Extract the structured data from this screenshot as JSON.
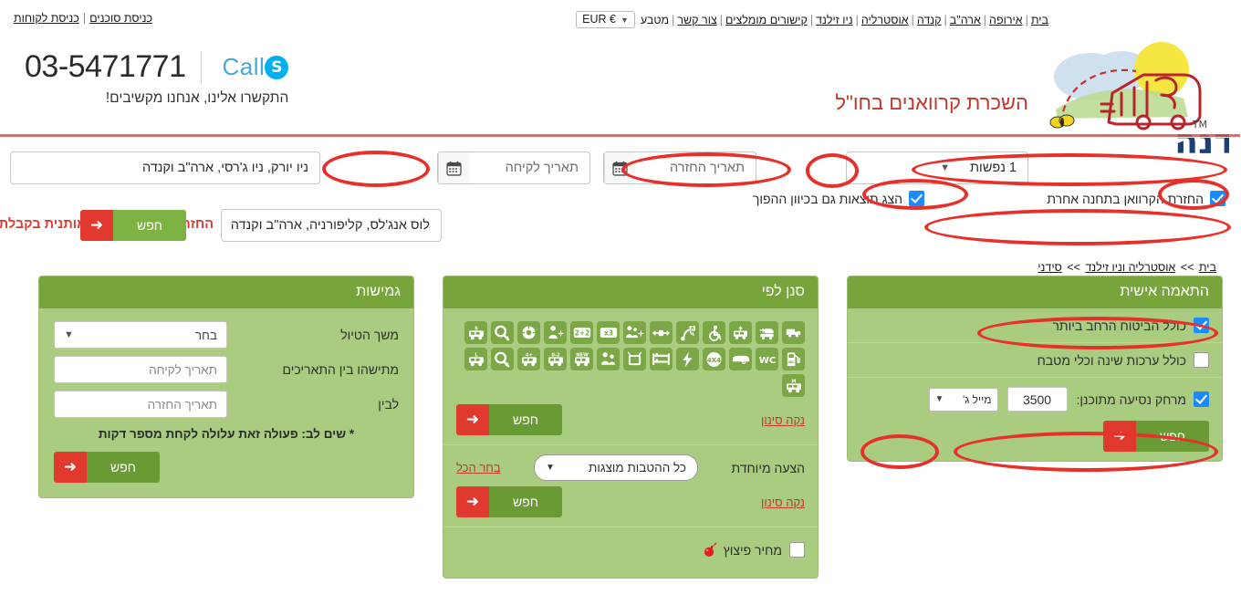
{
  "topbar": {
    "left_links": [
      {
        "label": "כניסת סוכנים"
      },
      {
        "label": "כניסת לקוחות"
      }
    ],
    "nav_links": [
      {
        "label": "בית"
      },
      {
        "label": "אירופה"
      },
      {
        "label": "ארה\"ב"
      },
      {
        "label": "קנדה"
      },
      {
        "label": "אוסטרליה"
      },
      {
        "label": "ניו זילנד"
      },
      {
        "label": "קישורים מומלצים"
      },
      {
        "label": "צור קשר"
      }
    ],
    "currency_label": "מטבע",
    "currency_value": "EUR €",
    "separator": "|"
  },
  "header": {
    "skype_label": "Call",
    "skype_icon": "skype-icon",
    "phone": "03-5471771",
    "tagline": "התקשרו אלינו, אנחנו מקשיבים!",
    "site_title": "השכרת קרוואנים בחו\"ל",
    "logo_text": "בנדנה",
    "logo_tm": "TM"
  },
  "search": {
    "pickup_place_value": "ניו יורק, ניו ג'רסי, ארה\"ב וקנדה",
    "pickup_date_placeholder": "תאריך לקיחה",
    "return_date_placeholder": "תאריך החזרה",
    "people_value": "1 נפשות",
    "calendar_icon": "calendar-icon",
    "chevron_icon": "chevron-down-icon",
    "checkbox_other_station": "החזרת הקרוואן בתחנה אחרת",
    "checkbox_reverse_results": "הצג תוצאות גם בכיוון ההפוך",
    "dropoff_place_value": "לוס אנג'לס, קליפורניה, ארה\"ב וקנדה",
    "warning_note": "החזרה בתחנה אחרת מותנית בקבלת אישור",
    "search_button": "חפש",
    "arrow_icon": "arrow-left-icon"
  },
  "breadcrumb": {
    "items": [
      {
        "label": "בית"
      },
      {
        "label": "אוסטרליה וניו זילנד"
      },
      {
        "label": "סידני"
      }
    ],
    "separator": ">>"
  },
  "panels": {
    "personal": {
      "title": "התאמה אישית",
      "opt_insurance": "כולל הביטוח הרחב ביותר",
      "opt_kitchen": "כולל ערכות שינה וכלי מטבח",
      "opt_distance": "מרחק נסיעה מתוכנן:",
      "distance_value": "3500",
      "distance_unit": "מייל ג'",
      "search_button": "חפש"
    },
    "filter": {
      "title": "סנן לפי",
      "icons": [
        {
          "name": "campervan-icon",
          "glyph": "van"
        },
        {
          "name": "motorhome-arrow-icon",
          "glyph": "van-arrow"
        },
        {
          "name": "motorhome-height-icon",
          "glyph": "van-up"
        },
        {
          "name": "wheelchair-icon",
          "glyph": "wheelchair"
        },
        {
          "name": "shower-auto-icon",
          "glyph": "showerA"
        },
        {
          "name": "bed-width-icon",
          "glyph": "bedwidth"
        },
        {
          "name": "family-plus-icon",
          "glyph": "familyplus"
        },
        {
          "name": "capacity-x3-icon",
          "glyph": "x3"
        },
        {
          "name": "capacity-2plus2-icon",
          "glyph": "2+2"
        },
        {
          "name": "person-plus-icon",
          "glyph": "personplus"
        },
        {
          "name": "steering-wheel-icon",
          "glyph": "wheel"
        },
        {
          "name": "magnifier-y-icon",
          "glyph": "magY"
        },
        {
          "name": "van-s-icon",
          "glyph": "vanS"
        },
        {
          "name": "gas-pump-icon",
          "glyph": "pump"
        },
        {
          "name": "wc-icon",
          "glyph": "WC"
        },
        {
          "name": "trailer-icon",
          "glyph": "trailer"
        },
        {
          "name": "four-by-four-icon",
          "glyph": "4X4"
        },
        {
          "name": "electricity-icon",
          "glyph": "bolt"
        },
        {
          "name": "bunk-bed-icon",
          "glyph": "bunk"
        },
        {
          "name": "tv-icon",
          "glyph": "tv"
        },
        {
          "name": "family-icon",
          "glyph": "family"
        },
        {
          "name": "van-new-icon",
          "glyph": "NEW"
        },
        {
          "name": "van-0-2-icon",
          "glyph": "0-2"
        },
        {
          "name": "van-plus4-icon",
          "glyph": "+4"
        },
        {
          "name": "magnifier-c-icon",
          "glyph": "magC"
        },
        {
          "name": "van-l-icon",
          "glyph": "vanL"
        },
        {
          "name": "van-m-icon",
          "glyph": "vanM"
        }
      ],
      "clear_filter": "נקה סינון",
      "search_button": "חפש",
      "special_offer_label": "הצעה מיוחדת",
      "special_offer_select": "כל ההטבות מוצגות",
      "select_all": "בחר הכל",
      "clear_filter_2": "נקה סינון",
      "search_button_2": "חפש",
      "blast_price_label": "מחיר פיצוץ",
      "bomb_icon": "bomb-icon"
    },
    "flexibility": {
      "title": "גמישות",
      "trip_length_label": "משך הטיול",
      "trip_length_value": "בחר",
      "between_dates_label": "מתישהו בין התאריכים",
      "pickup_date_placeholder": "תאריך לקיחה",
      "to_label": "לבין",
      "return_date_placeholder": "תאריך החזרה",
      "note": "* שים לב: פעולה זאת עלולה לקחת מספר דקות",
      "search_button": "חפש"
    }
  },
  "colors": {
    "panel_head_green": "#77a53c",
    "panel_body_green": "#a9cc80",
    "accent_red": "#e03a2f",
    "button_green": "#7cb342",
    "annotation_red": "#e8302a",
    "checkbox_blue": "#1a8cff",
    "title_red": "#c0392b"
  }
}
